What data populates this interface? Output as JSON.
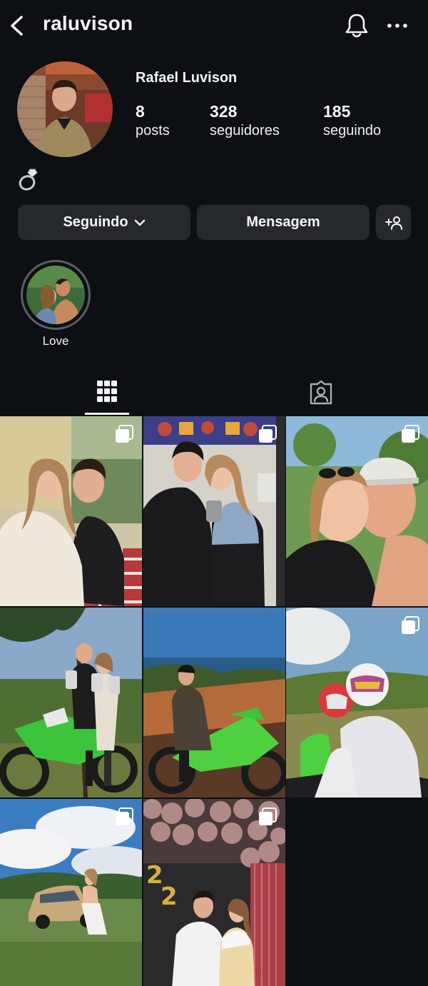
{
  "header": {
    "username": "raluvison",
    "back_icon": "chevron-left-icon",
    "bell_icon": "bell-icon",
    "more_icon": "more-horizontal-icon"
  },
  "profile": {
    "full_name": "Rafael Luvison",
    "bio_emoji_icon": "diamond-ring-icon",
    "stats": [
      {
        "value": "8",
        "label": "posts"
      },
      {
        "value": "328",
        "label": "seguidores"
      },
      {
        "value": "185",
        "label": "seguindo"
      }
    ]
  },
  "actions": {
    "following_label": "Seguindo",
    "message_label": "Mensagem",
    "add_user_icon": "add-user-icon"
  },
  "highlights": [
    {
      "label": "Love"
    }
  ],
  "tabs": [
    {
      "name": "posts-grid",
      "icon": "grid-icon",
      "active": true
    },
    {
      "name": "tagged",
      "icon": "tagged-user-icon",
      "active": false
    }
  ],
  "posts": [
    {
      "multi": true,
      "scene": "couple-indoors"
    },
    {
      "multi": true,
      "scene": "couple-mirror-selfie"
    },
    {
      "multi": true,
      "scene": "couple-closeup-selfie"
    },
    {
      "multi": false,
      "scene": "couple-motorcycle-trophies"
    },
    {
      "multi": false,
      "scene": "rider-on-green-motorcycle"
    },
    {
      "multi": true,
      "scene": "motocross-helmet-selfie"
    },
    {
      "multi": true,
      "scene": "vintage-car-field"
    },
    {
      "multi": true,
      "scene": "new-year-balloons"
    }
  ],
  "colors": {
    "background": "#0c1014",
    "button": "#25292e",
    "text": "#f5f5f5"
  }
}
